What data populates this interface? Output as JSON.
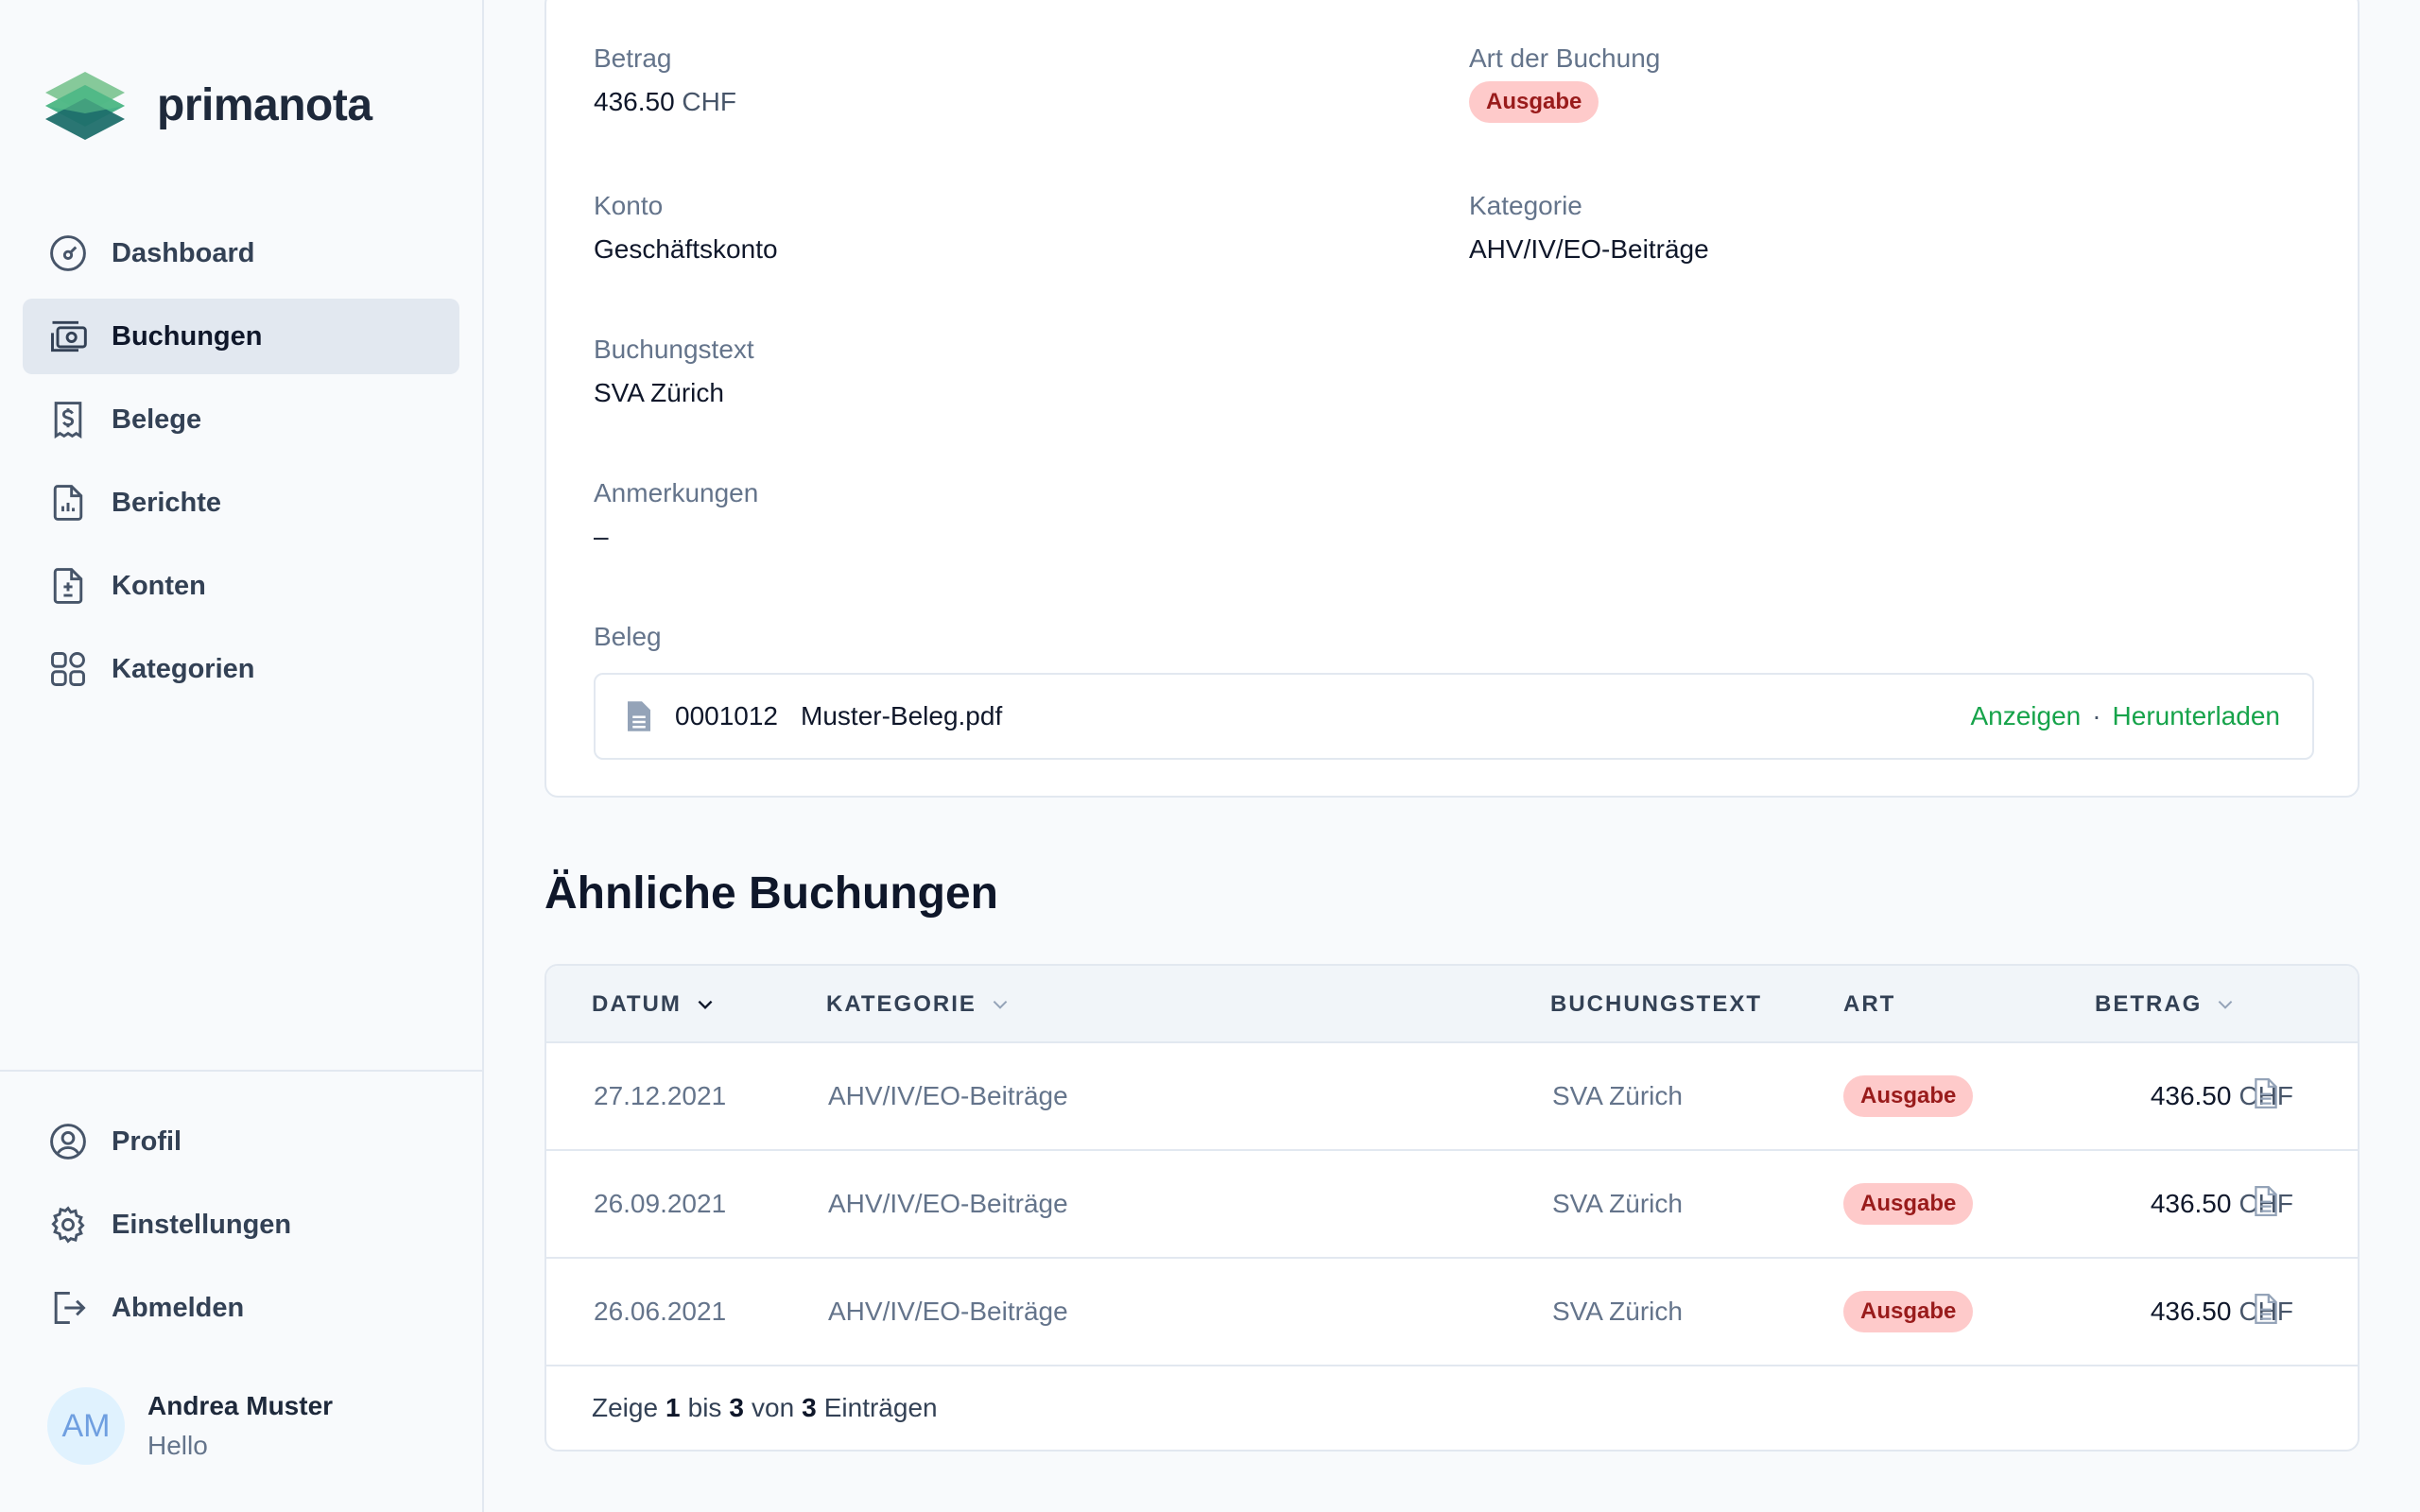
{
  "brand": {
    "name": "primanota"
  },
  "nav": {
    "main": [
      {
        "id": "dashboard",
        "label": "Dashboard",
        "icon": "gauge-icon",
        "active": false
      },
      {
        "id": "buchungen",
        "label": "Buchungen",
        "icon": "cash-icon",
        "active": true
      },
      {
        "id": "belege",
        "label": "Belege",
        "icon": "receipt-icon",
        "active": false
      },
      {
        "id": "berichte",
        "label": "Berichte",
        "icon": "report-icon",
        "active": false
      },
      {
        "id": "konten",
        "label": "Konten",
        "icon": "document-plusminus-icon",
        "active": false
      },
      {
        "id": "kategorien",
        "label": "Kategorien",
        "icon": "grid-icon",
        "active": false
      }
    ],
    "bottom": [
      {
        "id": "profil",
        "label": "Profil",
        "icon": "user-circle-icon"
      },
      {
        "id": "einstellungen",
        "label": "Einstellungen",
        "icon": "gear-icon"
      },
      {
        "id": "abmelden",
        "label": "Abmelden",
        "icon": "logout-icon"
      }
    ]
  },
  "user": {
    "initials": "AM",
    "name": "Andrea Muster",
    "subtitle": "Hello"
  },
  "detail": {
    "betrag": {
      "label": "Betrag",
      "value": "436.50",
      "unit": "CHF"
    },
    "art": {
      "label": "Art der Buchung",
      "value": "Ausgabe"
    },
    "konto": {
      "label": "Konto",
      "value": "Geschäftskonto"
    },
    "kategorie": {
      "label": "Kategorie",
      "value": "AHV/IV/EO-Beiträge"
    },
    "buchungstext": {
      "label": "Buchungstext",
      "value": "SVA Zürich"
    },
    "anmerkungen": {
      "label": "Anmerkungen",
      "value": "–"
    },
    "beleg": {
      "label": "Beleg",
      "number": "0001012",
      "filename": "Muster-Beleg.pdf",
      "view_label": "Anzeigen",
      "separator": "·",
      "download_label": "Herunterladen"
    }
  },
  "similar": {
    "title": "Ähnliche Buchungen",
    "columns": {
      "datum": "DATUM",
      "kategorie": "KATEGORIE",
      "buchungstext": "BUCHUNGSTEXT",
      "art": "ART",
      "betrag": "BETRAG"
    },
    "rows": [
      {
        "datum": "27.12.2021",
        "kategorie": "AHV/IV/EO-Beiträge",
        "buchungstext": "SVA Zürich",
        "art": "Ausgabe",
        "betrag": "436.50",
        "unit": "CHF"
      },
      {
        "datum": "26.09.2021",
        "kategorie": "AHV/IV/EO-Beiträge",
        "buchungstext": "SVA Zürich",
        "art": "Ausgabe",
        "betrag": "436.50",
        "unit": "CHF"
      },
      {
        "datum": "26.06.2021",
        "kategorie": "AHV/IV/EO-Beiträge",
        "buchungstext": "SVA Zürich",
        "art": "Ausgabe",
        "betrag": "436.50",
        "unit": "CHF"
      }
    ],
    "footer": {
      "prefix": "Zeige",
      "from": "1",
      "mid1": "bis",
      "to": "3",
      "mid2": "von",
      "total": "3",
      "suffix": "Einträgen"
    }
  },
  "colors": {
    "accent_green": "#16a34a",
    "badge_bg": "#fecaca",
    "badge_text": "#991b1b",
    "active_nav_bg": "#e2e8f0"
  }
}
